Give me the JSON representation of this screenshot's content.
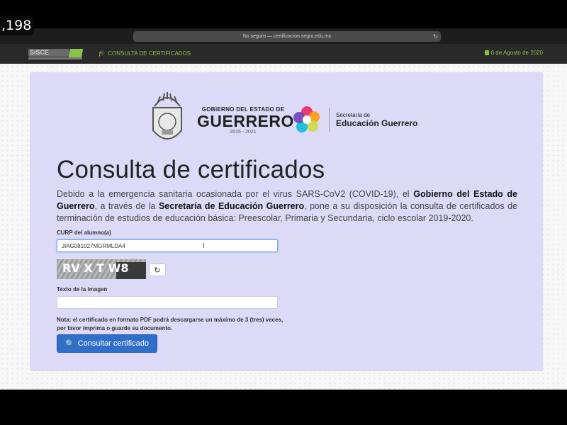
{
  "overlay": {
    "counter": ",198"
  },
  "browser": {
    "url_text": "No seguro — certificacion.segro.edu.mx"
  },
  "appnav": {
    "logo_text": "SiSCE",
    "link_label": "CONSULTA DE CERTIFICADOS",
    "date": "6 de Agosto de 2020"
  },
  "header": {
    "gov_line1": "GOBIERNO DEL ESTADO DE",
    "gov_line2": "GUERRERO",
    "gov_years": "2015 - 2021",
    "sec_line1": "Secretaría de",
    "sec_line2": "Educación Guerrero"
  },
  "main": {
    "title": "Consulta de certificados",
    "intro": {
      "part1": "Debido a la emergencia sanitaria ocasionada por el virus SARS-CoV2 (COVID-19), el ",
      "bold1": "Gobierno del Estado de Guerrero",
      "part2": ", a través de la ",
      "bold2": "Secretaría de Educación Guerrero",
      "part3": ", pone a su disposición la consulta de certificados de terminación de estudios de educación básica: Preescolar, Primaria y Secundaria, ciclo escolar 2019-2020."
    },
    "curp_label": "CURP del alumno(a)",
    "curp_value": "JIAG081027MGRMLDA4",
    "captcha_text": "RV X T W8",
    "image_text_label": "Texto de la imagen",
    "image_text_value": "",
    "note": "Nota: el certificado en formato PDF podrá descargarse un máximo de 3 (tres) veces, por favor imprima o guarde su documento.",
    "submit_label": "Consultar certificado"
  },
  "colors": {
    "accent_green": "#8bc34a",
    "button_blue": "#2f6fc9",
    "card_bg": "#dcdaf7"
  }
}
